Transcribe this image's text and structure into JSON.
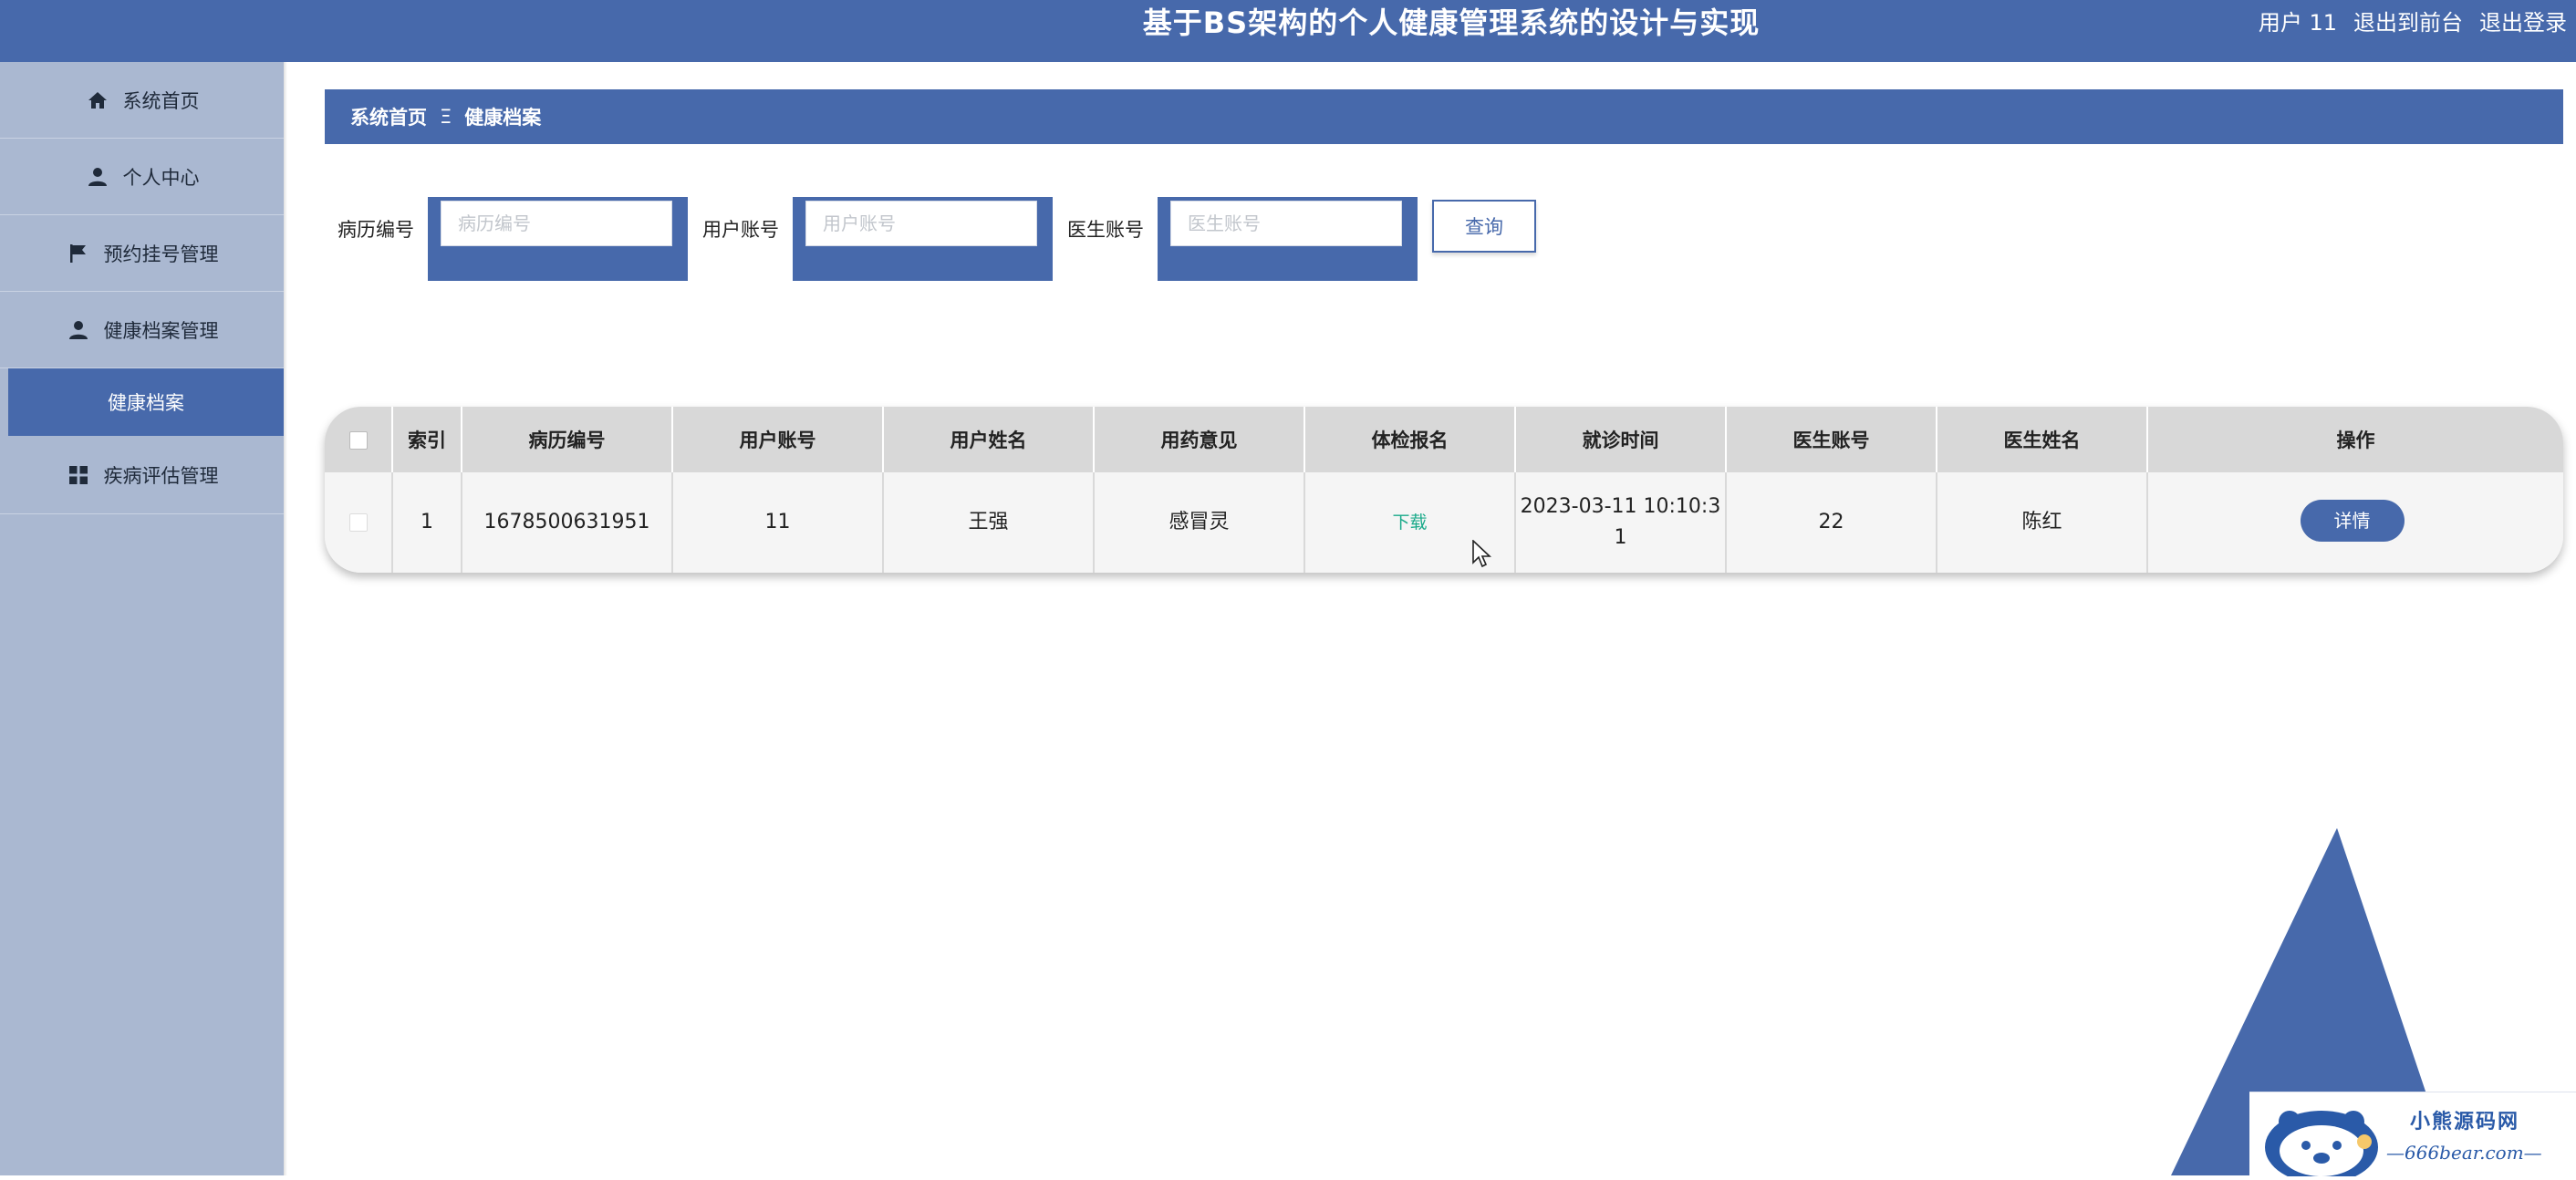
{
  "header": {
    "title": "基于BS架构的个人健康管理系统的设计与实现",
    "user_label": "用户 11",
    "to_front_label": "退出到前台",
    "logout_label": "退出登录"
  },
  "sidebar": {
    "items": [
      {
        "label": "系统首页",
        "icon": "home-icon"
      },
      {
        "label": "个人中心",
        "icon": "person-icon"
      },
      {
        "label": "预约挂号管理",
        "icon": "flag-icon"
      },
      {
        "label": "健康档案管理",
        "icon": "person-icon"
      },
      {
        "label": "疾病评估管理",
        "icon": "grid-icon"
      }
    ],
    "active_sub": "健康档案"
  },
  "breadcrumb": {
    "home": "系统首页",
    "separator": "Ξ",
    "current": "健康档案"
  },
  "search": {
    "record_no": {
      "label": "病历编号",
      "placeholder": "病历编号",
      "value": ""
    },
    "user_account": {
      "label": "用户账号",
      "placeholder": "用户账号",
      "value": ""
    },
    "doctor_account": {
      "label": "医生账号",
      "placeholder": "医生账号",
      "value": ""
    },
    "query_label": "查询"
  },
  "table": {
    "columns": [
      "索引",
      "病历编号",
      "用户账号",
      "用户姓名",
      "用药意见",
      "体检报名",
      "就诊时间",
      "医生账号",
      "医生姓名",
      "操作"
    ],
    "rows": [
      {
        "index": "1",
        "record_no": "1678500631951",
        "user_account": "11",
        "user_name": "王强",
        "medication": "感冒灵",
        "report_link": "下载",
        "visit_time_line1": "2023-03-11 10:10:3",
        "visit_time_line2": "1",
        "doctor_account": "22",
        "doctor_name": "陈红",
        "action_label": "详情"
      }
    ]
  },
  "watermark": {
    "name": "小熊源码网",
    "url": "—666bear.com—"
  },
  "colors": {
    "primary": "#4769ab",
    "sidebar_bg": "#aab8d1",
    "link_green": "#1aaa8a"
  }
}
